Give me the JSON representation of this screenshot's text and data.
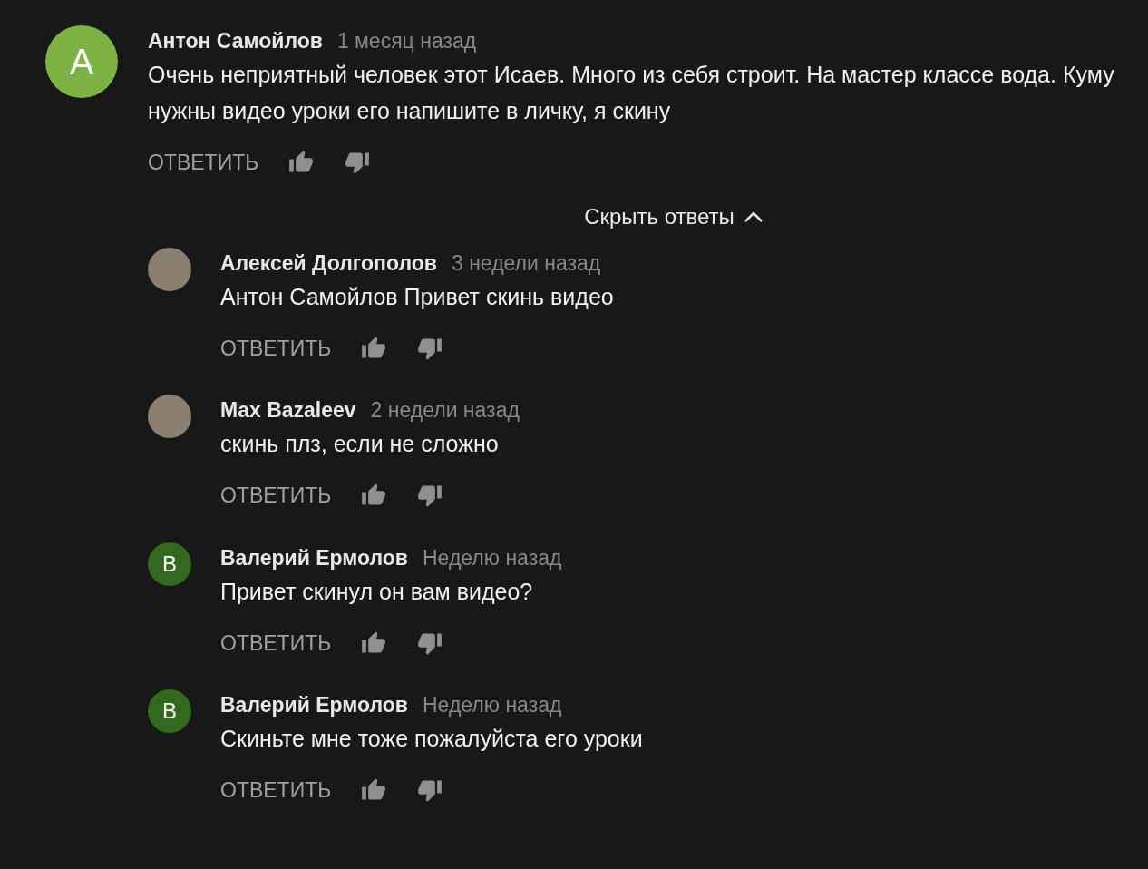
{
  "comment": {
    "author": "Антон Самойлов",
    "time": "1 месяц назад",
    "avatar": {
      "kind": "letter",
      "letter": "A",
      "color": "#7cb342"
    },
    "text": "Очень неприятный человек этот Исаев. Много из себя строит. На мастер классе вода. Куму нужны видео уроки его напишите в личку, я скину",
    "reply_label": "ОТВЕТИТЬ"
  },
  "toggle": {
    "label": "Скрыть ответы",
    "expanded": true
  },
  "replies": [
    {
      "author": "Алексей Долгополов",
      "time": "3 недели назад",
      "avatar": {
        "kind": "photo"
      },
      "text": "Антон Самойлов Привет скинь видео",
      "reply_label": "ОТВЕТИТЬ"
    },
    {
      "author": "Max Bazaleev",
      "time": "2 недели назад",
      "avatar": {
        "kind": "photo"
      },
      "text": "скинь плз, если не сложно",
      "reply_label": "ОТВЕТИТЬ"
    },
    {
      "author": "Валерий Ермолов",
      "time": "Неделю назад",
      "avatar": {
        "kind": "letter",
        "letter": "B",
        "color": "#33691e"
      },
      "text": "Привет скинул он вам видео?",
      "reply_label": "ОТВЕТИТЬ"
    },
    {
      "author": "Валерий Ермолов",
      "time": "Неделю назад",
      "avatar": {
        "kind": "letter",
        "letter": "B",
        "color": "#33691e"
      },
      "text": "Скиньте мне тоже пожалуйста его уроки",
      "reply_label": "ОТВЕТИТЬ"
    }
  ]
}
